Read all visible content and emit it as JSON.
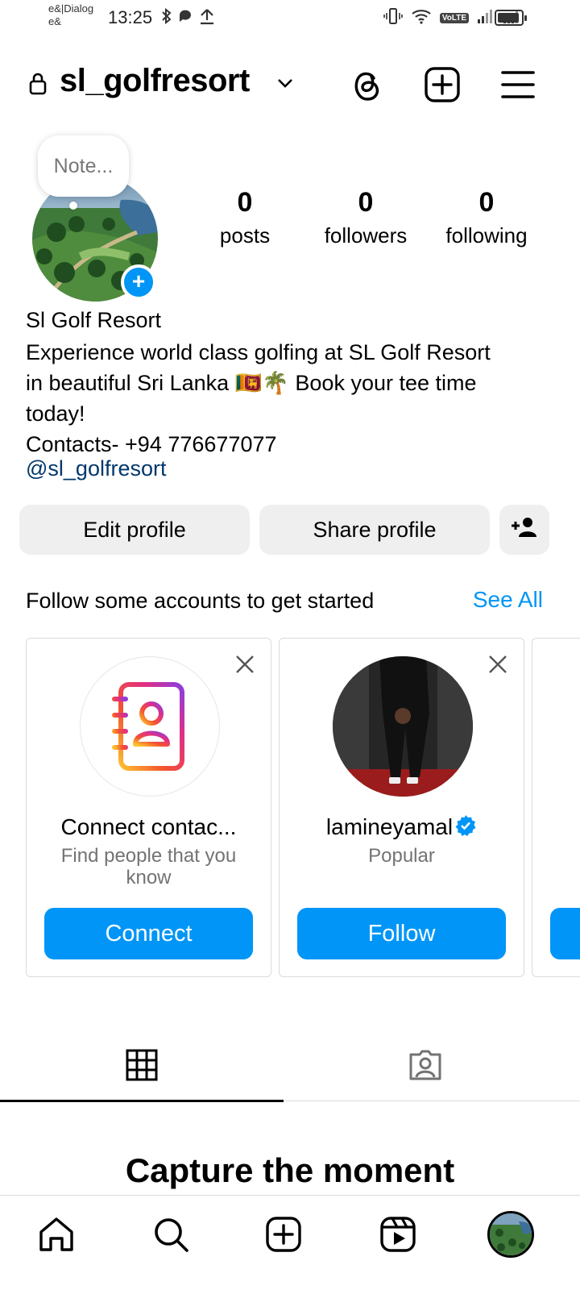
{
  "status_bar": {
    "carrier": "e&|Dialog e&",
    "time": "13:25",
    "volte": "VoLTE"
  },
  "header": {
    "username": "sl_golfresort",
    "icons": [
      "lock-icon",
      "chevron-down-icon",
      "threads-icon",
      "create-post-icon",
      "menu-icon"
    ]
  },
  "profile": {
    "note_placeholder": "Note...",
    "stats": [
      {
        "value": "0",
        "label": "posts"
      },
      {
        "value": "0",
        "label": "followers"
      },
      {
        "value": "0",
        "label": "following"
      }
    ],
    "display_name": "Sl Golf Resort",
    "bio_lines": [
      "Experience world class golfing at SL Golf Resort",
      "in beautiful Sri Lanka 🇱🇰🌴 Book your tee time",
      "today!",
      "Contacts-  +94 776677077"
    ],
    "handle_link": "@sl_golfresort"
  },
  "actions": {
    "edit_label": "Edit profile",
    "share_label": "Share profile"
  },
  "suggestions": {
    "title": "Follow some accounts to get started",
    "see_all": "See All",
    "cards": [
      {
        "name": "Connect contac...",
        "subtitle": "Find people that you know",
        "button": "Connect"
      },
      {
        "name": "lamineyamal",
        "subtitle": "Popular",
        "button": "Follow",
        "verified": true
      }
    ]
  },
  "tabs": [
    "grid-tab",
    "tagged-tab"
  ],
  "empty_state": {
    "title": "Capture the moment"
  },
  "bottom_nav": [
    "home-icon",
    "search-icon",
    "create-icon",
    "reels-icon",
    "profile-avatar"
  ],
  "colors": {
    "accent": "#0095f6",
    "link": "#00376b",
    "button_gray": "#efefef"
  }
}
